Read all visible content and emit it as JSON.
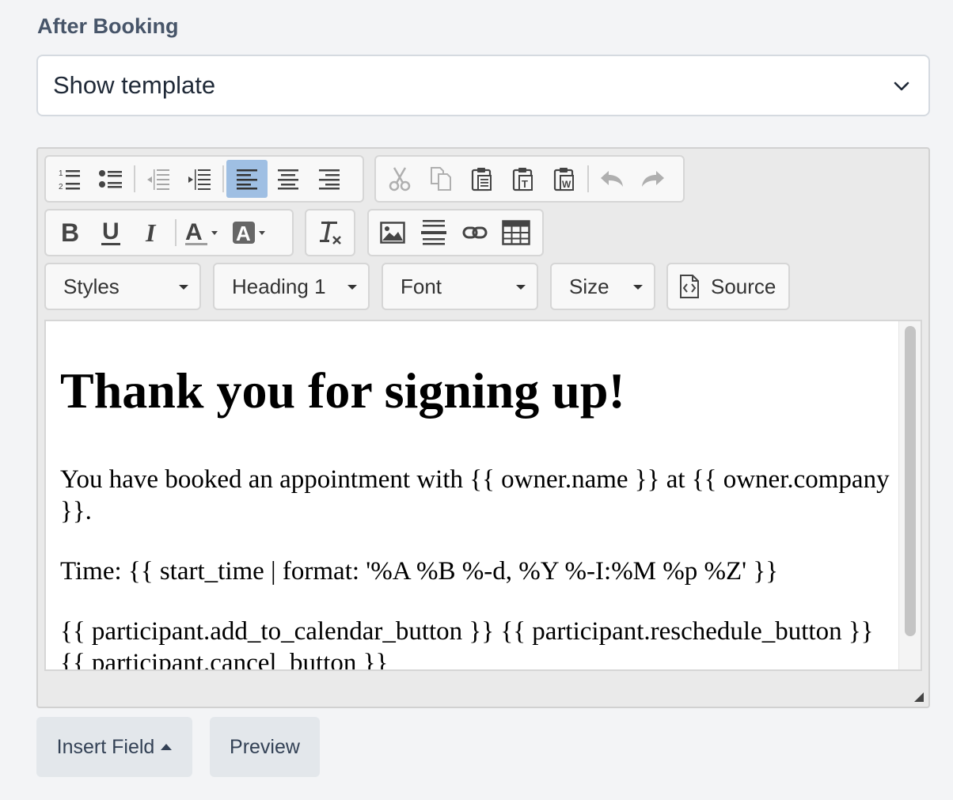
{
  "section": {
    "label": "After Booking"
  },
  "template_select": {
    "value": "Show template"
  },
  "toolbar": {
    "row1": {
      "list_group": [
        "numbered-list",
        "bulleted-list",
        "decrease-indent",
        "increase-indent",
        "align-left",
        "align-center",
        "align-right"
      ],
      "clipboard_group": [
        "cut",
        "copy",
        "paste",
        "paste-text",
        "paste-word",
        "undo",
        "redo"
      ],
      "active": "align-left"
    },
    "row2": {
      "format_group": [
        "bold",
        "underline",
        "italic",
        "text-color",
        "background-color"
      ],
      "clear_group": [
        "remove-format"
      ],
      "insert_group": [
        "image",
        "horizontal-line",
        "link",
        "table"
      ]
    },
    "combos": {
      "styles": "Styles",
      "format": "Heading 1",
      "font": "Font",
      "size": "Size"
    },
    "source_label": "Source"
  },
  "content": {
    "heading": "Thank you for signing up!",
    "para1": "You have booked an appointment with {{ owner.name }} at {{ owner.company }}.",
    "para2": "Time: {{ start_time | format: '%A %B %-d, %Y %-I:%M %p %Z' }}",
    "para3": "{{ participant.add_to_calendar_button }} {{ participant.reschedule_button }} {{ participant.cancel_button }}"
  },
  "actions": {
    "insert_field": "Insert Field",
    "preview": "Preview"
  }
}
